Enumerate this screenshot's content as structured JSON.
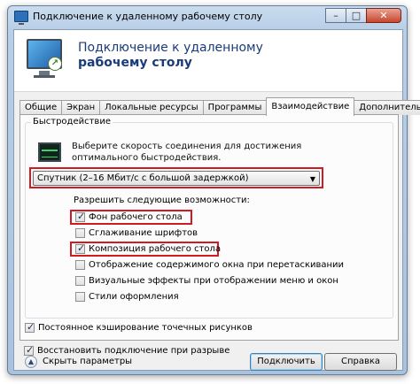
{
  "window": {
    "title": "Подключение к удаленному рабочему столу",
    "minimize_glyph": "–",
    "maximize_glyph": "□",
    "close_glyph": "✕"
  },
  "header": {
    "title_line1": "Подключение к удаленному",
    "title_line2": "рабочему столу"
  },
  "tabs": [
    {
      "label": "Общие"
    },
    {
      "label": "Экран"
    },
    {
      "label": "Локальные ресурсы"
    },
    {
      "label": "Программы"
    },
    {
      "label": "Взаимодействие",
      "active": true
    },
    {
      "label": "Дополнительно"
    }
  ],
  "performance": {
    "group_label": "Быстродействие",
    "description": "Выберите скорость соединения для достижения оптимального быстродействия.",
    "speed_select": "Спутник (2–16 Мбит/с с большой задержкой)",
    "allow_label": "Разрешить следующие возможности:",
    "options": [
      {
        "label": "Фон рабочего стола",
        "checked": true
      },
      {
        "label": "Сглаживание шрифтов",
        "checked": false
      },
      {
        "label": "Композиция рабочего стола",
        "checked": true
      },
      {
        "label": "Отображение содержимого окна при перетаскивании",
        "checked": false
      },
      {
        "label": "Визуальные эффекты при отображении меню и окон",
        "checked": false
      },
      {
        "label": "Стили оформления",
        "checked": false
      }
    ]
  },
  "extra_options": [
    {
      "label": "Постоянное кэширование точечных рисунков",
      "checked": true
    },
    {
      "label": "Восстановить подключение при разрыве",
      "checked": true
    }
  ],
  "footer": {
    "hide_label": "Скрыть параметры",
    "connect_label": "Подключить",
    "help_label": "Справка"
  },
  "colors": {
    "highlight": "#d21a22",
    "header_title": "#1b3c7a"
  },
  "icons": {
    "title": "remote-desktop-icon",
    "header": "monitor-icon",
    "performance": "performance-monitor-icon",
    "hide": "chevron-up-icon",
    "dropdown": "dropdown-arrow-icon"
  }
}
